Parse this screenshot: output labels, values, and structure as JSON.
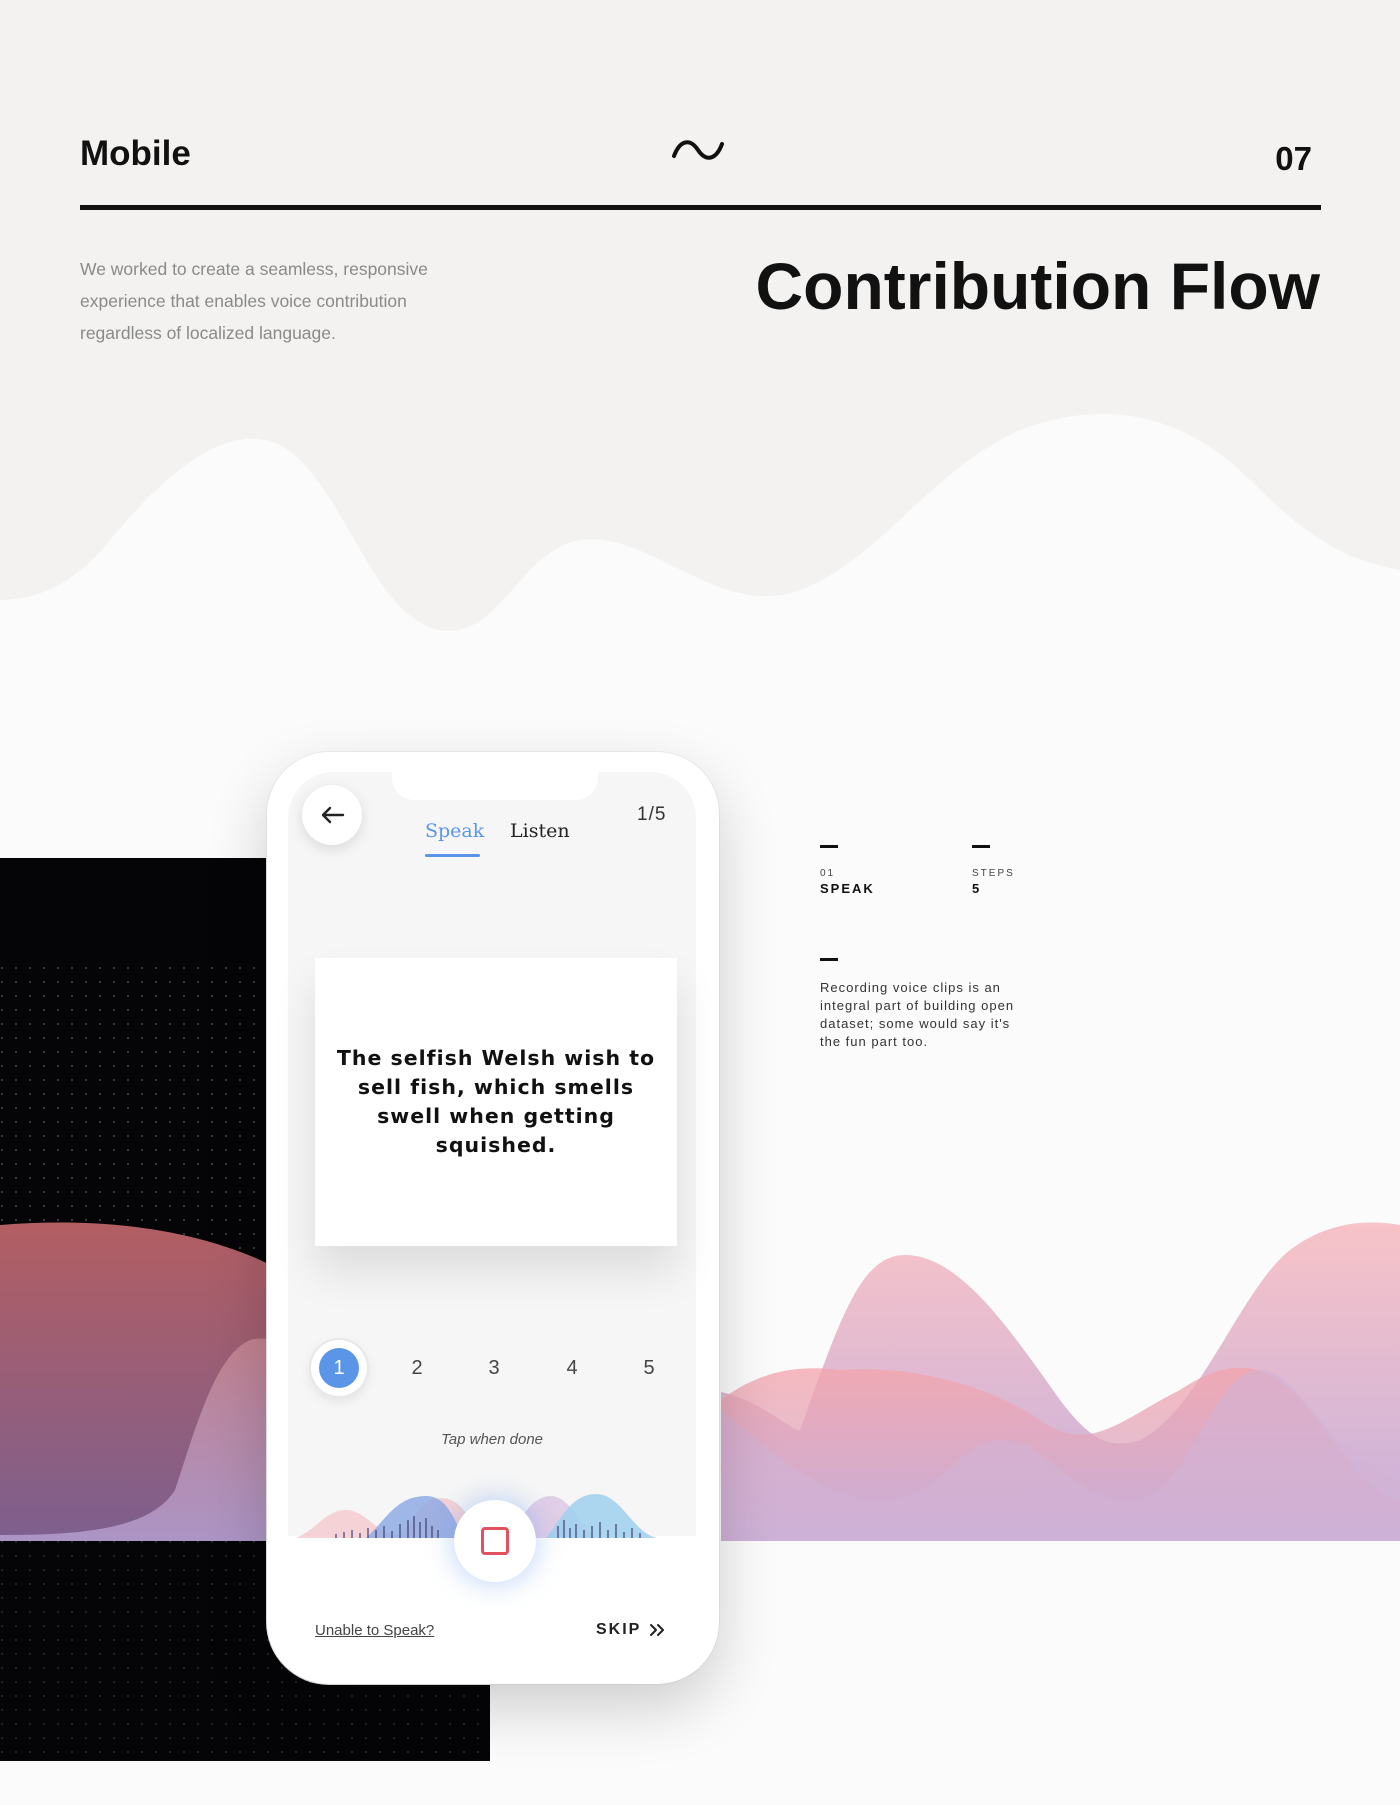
{
  "header": {
    "section": "Mobile",
    "page_number": "07",
    "tilde_icon": "tilde-wave-icon"
  },
  "intro": "We worked to create a seamless, responsive experience that enables voice contribution regardless of localized language.",
  "title": "Contribution Flow",
  "meta": {
    "step_index": "01",
    "step_name": "SPEAK",
    "steps_label": "STEPS",
    "steps_value": "5",
    "description": "Recording voice clips is an integral part of building open dataset; some would say it's the fun part too."
  },
  "phone": {
    "back_icon": "arrow-left-icon",
    "tabs": [
      {
        "label": "Speak",
        "active": true
      },
      {
        "label": "Listen",
        "active": false
      }
    ],
    "counter": "1/5",
    "sentence": "The selfish Welsh wish to sell fish, which smells swell when getting squished.",
    "steps": [
      "1",
      "2",
      "3",
      "4",
      "5"
    ],
    "active_step": "1",
    "tap_hint": "Tap when done",
    "record_icon": "stop-square-icon",
    "unable_link": "Unable to Speak?",
    "skip_label": "SKIP",
    "skip_icon": "double-chevron-right-icon"
  },
  "colors": {
    "accent_blue": "#5a95e8",
    "record_red": "#e2515f",
    "wave_pink": "#f3a6ad",
    "wave_purple": "#c6a9d4"
  }
}
